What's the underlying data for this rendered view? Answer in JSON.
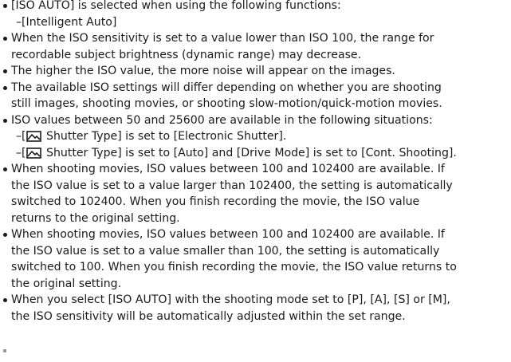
{
  "bullets": [
    {
      "lines": [
        "[ISO AUTO] is selected when using the following functions:"
      ],
      "subs": [
        "–[Intelligent Auto]"
      ]
    },
    {
      "lines": [
        "When the ISO sensitivity is set to a value lower than ISO 100, the range for",
        "recordable subject brightness (dynamic range) may decrease."
      ]
    },
    {
      "lines": [
        "The higher the ISO value, the more noise will appear on the images."
      ]
    },
    {
      "lines": [
        "The available ISO settings will differ depending on whether you are shooting",
        "still images, shooting movies, or shooting slow-motion/quick-motion movies."
      ]
    },
    {
      "lines": [
        "ISO values between 50 and 25600 are available in the following situations:"
      ],
      "icon_subs": [
        {
          "prefix": "–[",
          "icon": "still-image-icon",
          "text": " Shutter Type] is set to [Electronic Shutter]."
        },
        {
          "prefix": "–[",
          "icon": "still-image-icon",
          "text": " Shutter Type] is set to [Auto] and [Drive Mode] is set to [Cont. Shooting]."
        }
      ]
    },
    {
      "lines": [
        "When shooting movies, ISO values between 100 and 102400 are available. If",
        "the ISO value is set to a value larger than 102400, the setting is automatically",
        "switched to 102400. When you finish recording the movie, the ISO value",
        "returns to the original setting."
      ]
    },
    {
      "lines": [
        "When shooting movies, ISO values between 100 and 102400 are available. If",
        "the ISO value is set to a value smaller than 100, the setting is automatically",
        "switched to 100. When you finish recording the movie, the ISO value returns to",
        "the original setting."
      ]
    },
    {
      "lines": [
        "When you select [ISO AUTO] with the shooting mode set to [P], [A], [S] or [M],",
        "the ISO sensitivity will be automatically adjusted within the set range."
      ]
    }
  ]
}
